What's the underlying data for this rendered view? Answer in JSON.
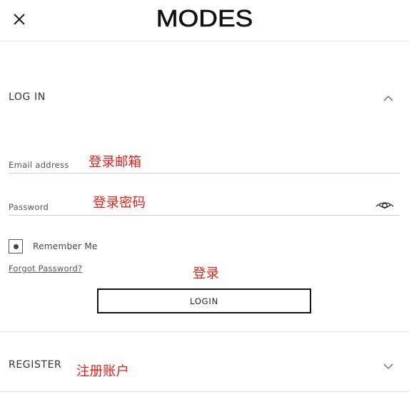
{
  "header": {
    "brand": "MODES",
    "close_icon": "close-icon"
  },
  "login_section": {
    "title": "LOG IN",
    "toggle_icon": "chevron-up-icon",
    "email": {
      "label": "Email address",
      "value": ""
    },
    "password": {
      "label": "Password",
      "value": "",
      "toggle_icon": "eye-icon"
    },
    "remember": {
      "label": "Remember Me",
      "checked": true
    },
    "forgot_label": "Forgot Password?",
    "login_label": "LOGIN"
  },
  "register_section": {
    "title": "REGISTER",
    "toggle_icon": "chevron-down-icon"
  },
  "annotations": {
    "email": "登录邮箱",
    "password": "登录密码",
    "login": "登录",
    "register": "注册账户"
  },
  "colors": {
    "annotation": "#e0201c",
    "text": "#222222",
    "border": "#cfcfcf"
  }
}
